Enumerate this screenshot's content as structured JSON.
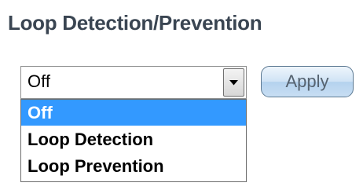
{
  "header": {
    "title": "Loop Detection/Prevention"
  },
  "mode_select": {
    "selected_value": "Off",
    "options": [
      {
        "label": "Off",
        "highlighted": true
      },
      {
        "label": "Loop Detection",
        "highlighted": false
      },
      {
        "label": "Loop Prevention",
        "highlighted": false
      }
    ],
    "arrow_icon": "chevron-down-icon",
    "highlight_color": "#3399ff"
  },
  "actions": {
    "apply_label": "Apply"
  }
}
